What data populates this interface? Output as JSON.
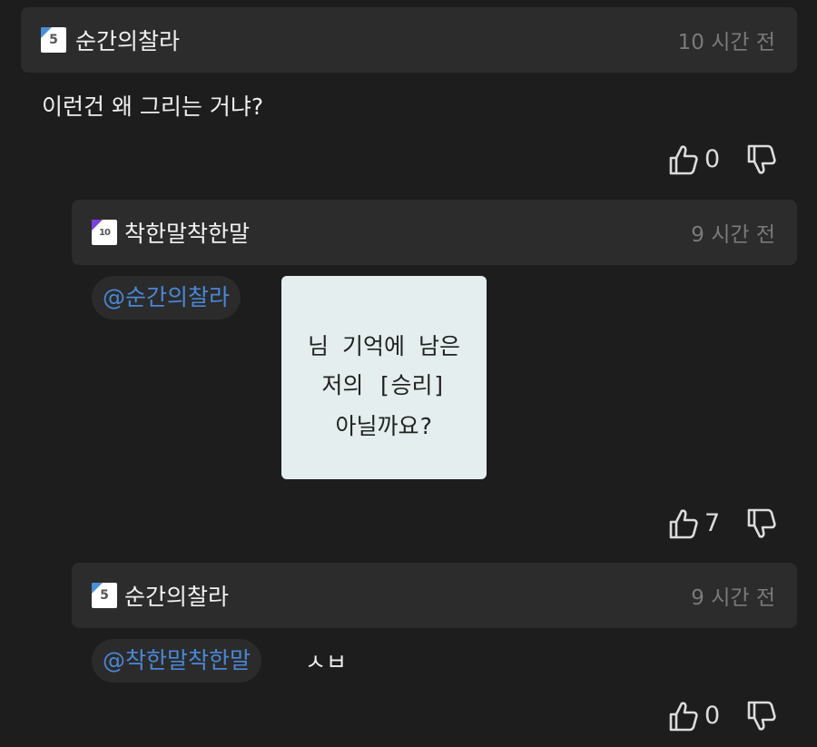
{
  "comments": [
    {
      "username": "순간의찰라",
      "level_badge": "5",
      "timestamp": "10 시간 전",
      "text": "이런건 왜 그리는 거냐?",
      "like_count": "0"
    },
    {
      "username": "착한말착한말",
      "level_badge": "10",
      "timestamp": "9 시간 전",
      "mention": "@순간의찰라",
      "sticker_lines": [
        "님 기억에 남은",
        "저의 [승리]",
        "아닐까요?"
      ],
      "like_count": "7"
    },
    {
      "username": "순간의찰라",
      "level_badge": "5",
      "timestamp": "9 시간 전",
      "mention": "@착한말착한말",
      "text": "ㅅㅂ",
      "like_count": "0"
    }
  ],
  "icons": {
    "like": "thumbs-up-icon",
    "dislike": "thumbs-down-icon",
    "badge_blue": "#4a8fd8",
    "badge_purple": "#7b3fe0",
    "mention_color": "#4a87d6"
  }
}
